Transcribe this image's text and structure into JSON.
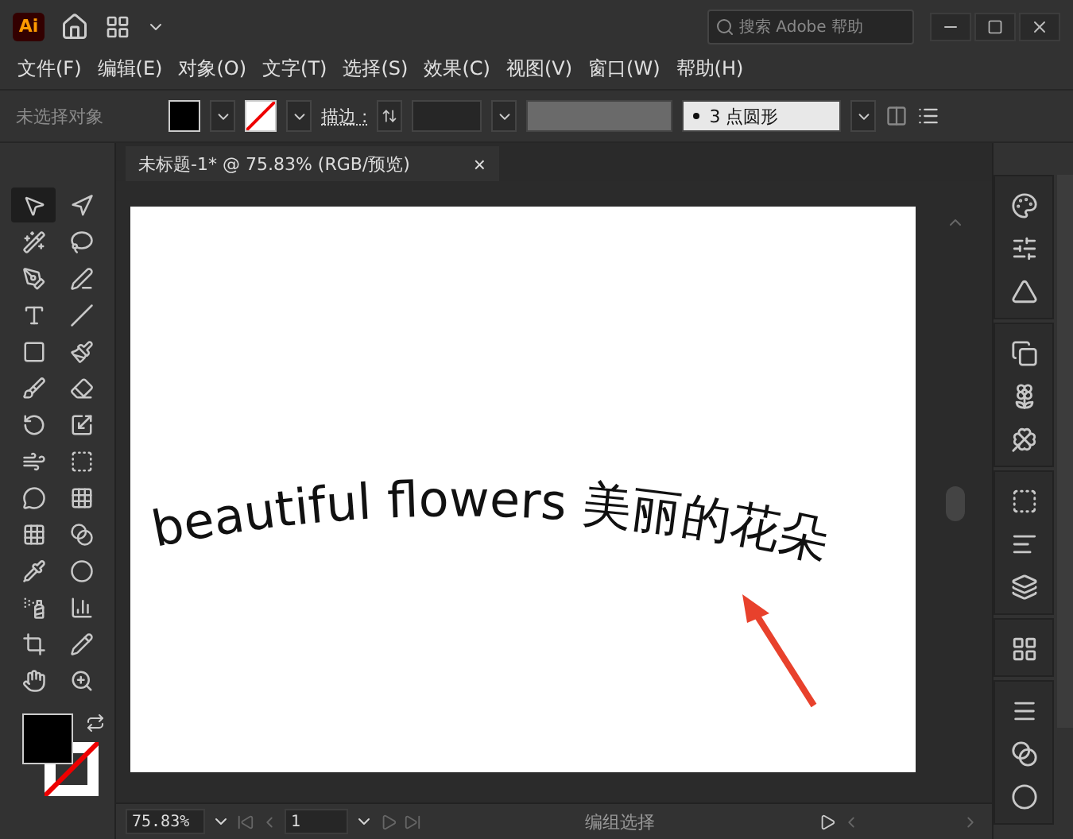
{
  "title_bar": {
    "app_badge": "Ai",
    "search_placeholder": "搜索 Adobe 帮助"
  },
  "menu": [
    "文件(F)",
    "编辑(E)",
    "对象(O)",
    "文字(T)",
    "选择(S)",
    "效果(C)",
    "视图(V)",
    "窗口(W)",
    "帮助(H)"
  ],
  "control_bar": {
    "selection": "未选择对象",
    "stroke_label": "描边 :",
    "brush": "3 点圆形"
  },
  "document_tab": {
    "title": "未标题-1* @ 75.83% (RGB/预览)",
    "close": "×"
  },
  "artboard": {
    "text": "beautiful flowers 美丽的花朵"
  },
  "tools": [
    {
      "selected": true
    },
    {
      "selected": false
    },
    {
      "selected": false
    },
    {
      "selected": false
    },
    {
      "selected": false
    },
    {
      "selected": false
    },
    {
      "selected": false
    },
    {
      "selected": false
    },
    {
      "selected": false
    },
    {
      "selected": false
    },
    {
      "selected": false
    },
    {
      "selected": false
    },
    {
      "selected": false
    },
    {
      "selected": false
    },
    {
      "selected": false
    },
    {
      "selected": false
    },
    {
      "selected": false
    },
    {
      "selected": false
    },
    {
      "selected": false
    },
    {
      "selected": false
    },
    {
      "selected": false
    },
    {
      "selected": false
    },
    {
      "selected": false
    },
    {
      "selected": false
    },
    {
      "selected": false
    },
    {
      "selected": false
    },
    {
      "selected": false
    },
    {
      "selected": false
    }
  ],
  "status_bar": {
    "zoom": "75.83%",
    "page": "1",
    "status": "编组选择"
  }
}
